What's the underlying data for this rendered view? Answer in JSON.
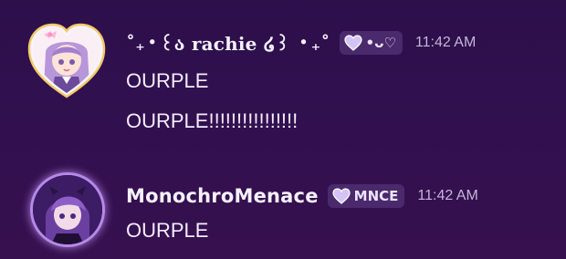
{
  "messages": [
    {
      "author": "˚₊‧꒰ა rachie ໒꒱ ‧₊˚",
      "tag": "•ᴗ♡",
      "tag_icon": "pastel-heart-icon",
      "timestamp": "11:42 AM",
      "avatar": "heart-framed-avatar",
      "lines": [
        "OURPLE",
        "OURPLE!!!!!!!!!!!!!!!!"
      ]
    },
    {
      "author": "MonochroMenace",
      "tag": "MNCE",
      "tag_icon": "pastel-heart-icon",
      "timestamp": "11:42 AM",
      "avatar": "round-glow-avatar",
      "lines": [
        "OURPLE"
      ]
    }
  ],
  "colors": {
    "background": "#32104f",
    "text": "#f2ecfb",
    "timestamp": "#c3b6d6",
    "tag_bg": "#4a2a6c",
    "glow": "#c599ff"
  }
}
